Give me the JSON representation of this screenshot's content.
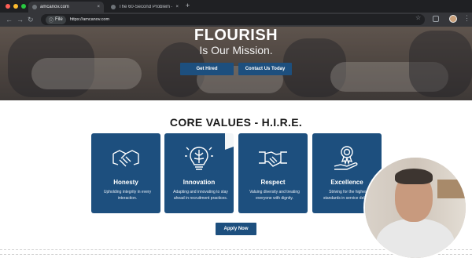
{
  "browser": {
    "tabs": [
      {
        "title": "amcanov.com",
        "close": "×"
      },
      {
        "title": "The 60-Second Problem — S",
        "close": "×"
      }
    ],
    "new_tab": "+",
    "nav": {
      "back": "←",
      "forward": "→",
      "reload": "↻"
    },
    "omnibox": {
      "chip_label": "File",
      "url": "https://amcanov.com"
    },
    "star": "☆",
    "menu": "⋮",
    "traffic_lights": [
      "#ff5f57",
      "#febc2e",
      "#28c840"
    ]
  },
  "hero": {
    "title": "FLOURISH",
    "subtitle": "Is Our Mission.",
    "buttons": [
      {
        "label": "Get Hired"
      },
      {
        "label": "Contact Us Today"
      }
    ]
  },
  "core_values": {
    "title": "CORE VALUES - H.I.R.E.",
    "cards": [
      {
        "icon": "handshake-icon",
        "title": "Honesty",
        "description": "Upholding integrity in every interaction."
      },
      {
        "icon": "lightbulb-brain-icon",
        "title": "Innovation",
        "description": "Adapting and innovating to stay ahead in recruitment practices."
      },
      {
        "icon": "handshake-icon",
        "title": "Respect",
        "description": "Valuing diversity and treating everyone with dignity."
      },
      {
        "icon": "award-hand-icon",
        "title": "Excellence",
        "description": "Striving for the highest standards in service delivery."
      }
    ],
    "apply_label": "Apply Now"
  },
  "colors": {
    "brand_blue": "#1d4f7e",
    "browser_dark": "#202124"
  }
}
